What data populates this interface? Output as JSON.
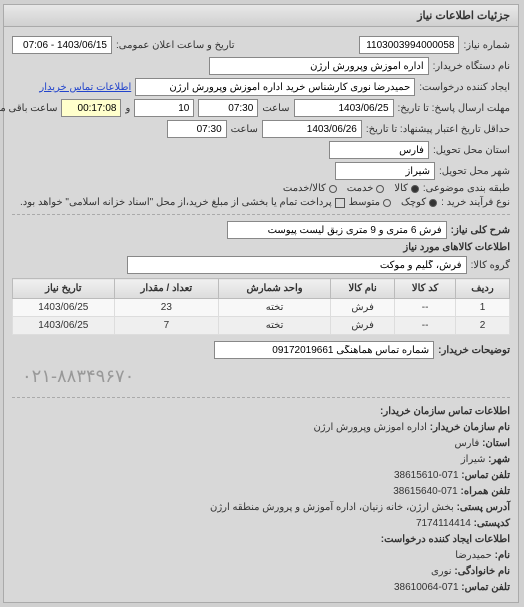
{
  "header": "جزئیات اطلاعات نیاز",
  "req": {
    "num_label": "شماره نیاز:",
    "num": "1103003994000058",
    "announce_label": "تاریخ و ساعت اعلان عمومی:",
    "announce": "1403/06/15 - 07:06",
    "org_label": "نام دستگاه خریدار:",
    "org": "اداره اموزش وپرورش ارژن",
    "creator_label": "ایجاد کننده درخواست:",
    "creator": "حمیدرضا نوری کارشناس خرید اداره اموزش وپرورش ارژن",
    "contact_link": "اطلاعات تماس خریدار",
    "deadline_label": "مهلت ارسال پاسخ: تا تاریخ:",
    "deadline_date": "1403/06/25",
    "time_label": "ساعت",
    "deadline_time": "07:30",
    "and_label": "و",
    "days": "10",
    "remain_label": "ساعت باقی مانده",
    "remain_time": "00:17:08",
    "delivery_label": "حداقل تاریخ اعتبار پیشنهاد: تا تاریخ:",
    "delivery_date": "1403/06/26",
    "delivery_time": "07:30",
    "province_label": "استان محل تحویل:",
    "province": "فارس",
    "city_label": "شهر محل تحویل:",
    "city": "شیراز",
    "cat_label": "طبقه بندی موضوعی:",
    "cat_opts": [
      "کالا",
      "خدمت",
      "کالا/خدمت"
    ],
    "proc_label": "نوع فرآیند خرید :",
    "proc_opts": [
      "کوچک",
      "متوسط"
    ],
    "pay_note": "پرداخت تمام یا بخشی از مبلغ خرید،از محل \"اسناد خزانه اسلامی\" خواهد بود.",
    "desc_label": "شرح کلی نیاز:",
    "desc": "فرش 6 متری و 9 متری زبق لیست پیوست",
    "items_header": "اطلاعات کالاهای مورد نیاز",
    "group_label": "گروه کالا:",
    "group": "فرش، گلیم و موکت",
    "note_label": "توضیحات خریدار:",
    "note": "شماره تماس هماهنگی 09172019661"
  },
  "table": {
    "cols": [
      "ردیف",
      "کد کالا",
      "نام کالا",
      "واحد شمارش",
      "تعداد / مقدار",
      "تاریخ نیاز"
    ],
    "rows": [
      [
        "1",
        "--",
        "فرش",
        "تخته",
        "23",
        "1403/06/25"
      ],
      [
        "2",
        "--",
        "فرش",
        "تخته",
        "7",
        "1403/06/25"
      ]
    ]
  },
  "contact": {
    "header": "اطلاعات تماس سازمان خریدار:",
    "org_label": "نام سازمان خریدار:",
    "org": "اداره اموزش وپرورش ارژن",
    "prov_label": "استان:",
    "prov": "فارس",
    "city_label": "شهر:",
    "city": "شیراز",
    "tel_label": "تلفن تماس:",
    "tel": "071-38615610",
    "fax_label": "تلفن همراه:",
    "fax": "071-38615640",
    "addr_label": "آدرس پستی:",
    "addr": "بخش ارژن، خانه زنیان، اداره آموزش و پرورش منطقه ارژن",
    "zip_label": "کدپستی:",
    "zip": "7174114414",
    "creator_header": "اطلاعات ایجاد کننده درخواست:",
    "fname_label": "نام:",
    "fname": "حمیدرضا",
    "lname_label": "نام خانوادگی:",
    "lname": "نوری",
    "ctel_label": "تلفن تماس:",
    "ctel": "071-38610064"
  },
  "big_phone": "۰۲۱-۸۸۳۴۹۶۷۰"
}
